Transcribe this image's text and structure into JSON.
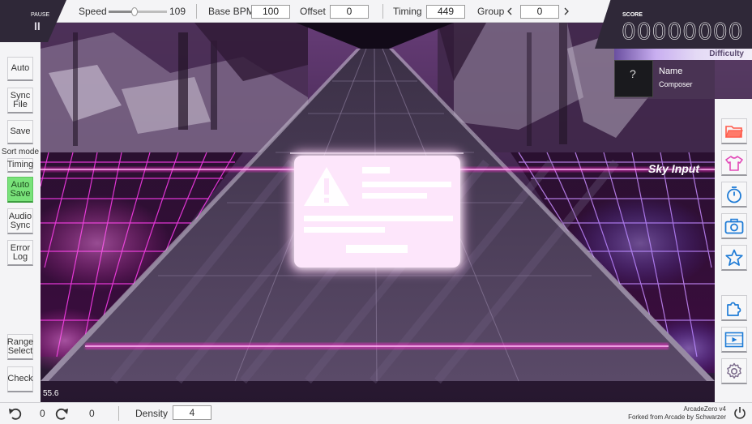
{
  "pause": {
    "label": "PAUSE",
    "glyph": "II"
  },
  "toolbar": {
    "speed_label": "Speed",
    "speed_value": "109",
    "speed_level": 0.45,
    "base_bpm_label": "Base BPM",
    "base_bpm_value": "100",
    "offset_label": "Offset",
    "offset_value": "0",
    "timing_label": "Timing",
    "timing_value": "449",
    "group_label": "Group",
    "group_value": "0"
  },
  "score": {
    "label": "SCORE",
    "value": "00000000",
    "difficulty_label": "Difficulty",
    "jacket_glyph": "?",
    "name": "Name",
    "composer": "Composer"
  },
  "left_sidebar": {
    "auto": "Auto",
    "sync_file_1": "Sync",
    "sync_file_2": "File",
    "save": "Save",
    "sort_mode_label": "Sort mode",
    "sort_mode_value": "Timing",
    "auto_save_1": "Auto",
    "auto_save_2": "Save",
    "audio_sync_1": "Audio",
    "audio_sync_2": "Sync",
    "error_log_1": "Error",
    "error_log_2": "Log",
    "range_select_1": "Range",
    "range_select_2": "Select",
    "check": "Check"
  },
  "right_sidebar": {
    "icons": [
      "folder-icon",
      "shirt-icon",
      "stopwatch-icon",
      "camera-icon",
      "star-icon",
      "puzzle-icon",
      "video-icon",
      "gear-icon"
    ]
  },
  "scene": {
    "sky_input": "Sky Input",
    "fps": "55.6"
  },
  "bottom": {
    "undo_count": "0",
    "redo_count": "0",
    "density_label": "Density",
    "density_value": "4",
    "app_name": "ArcadeZero v4",
    "fork_credit": "Forked from Arcade by Schwarzer"
  },
  "colors": {
    "accent_pink": "#ff2fd0",
    "panel_dark": "#2f2838",
    "active_green": "#79e27a",
    "icon_blue": "#1e7bd6"
  }
}
